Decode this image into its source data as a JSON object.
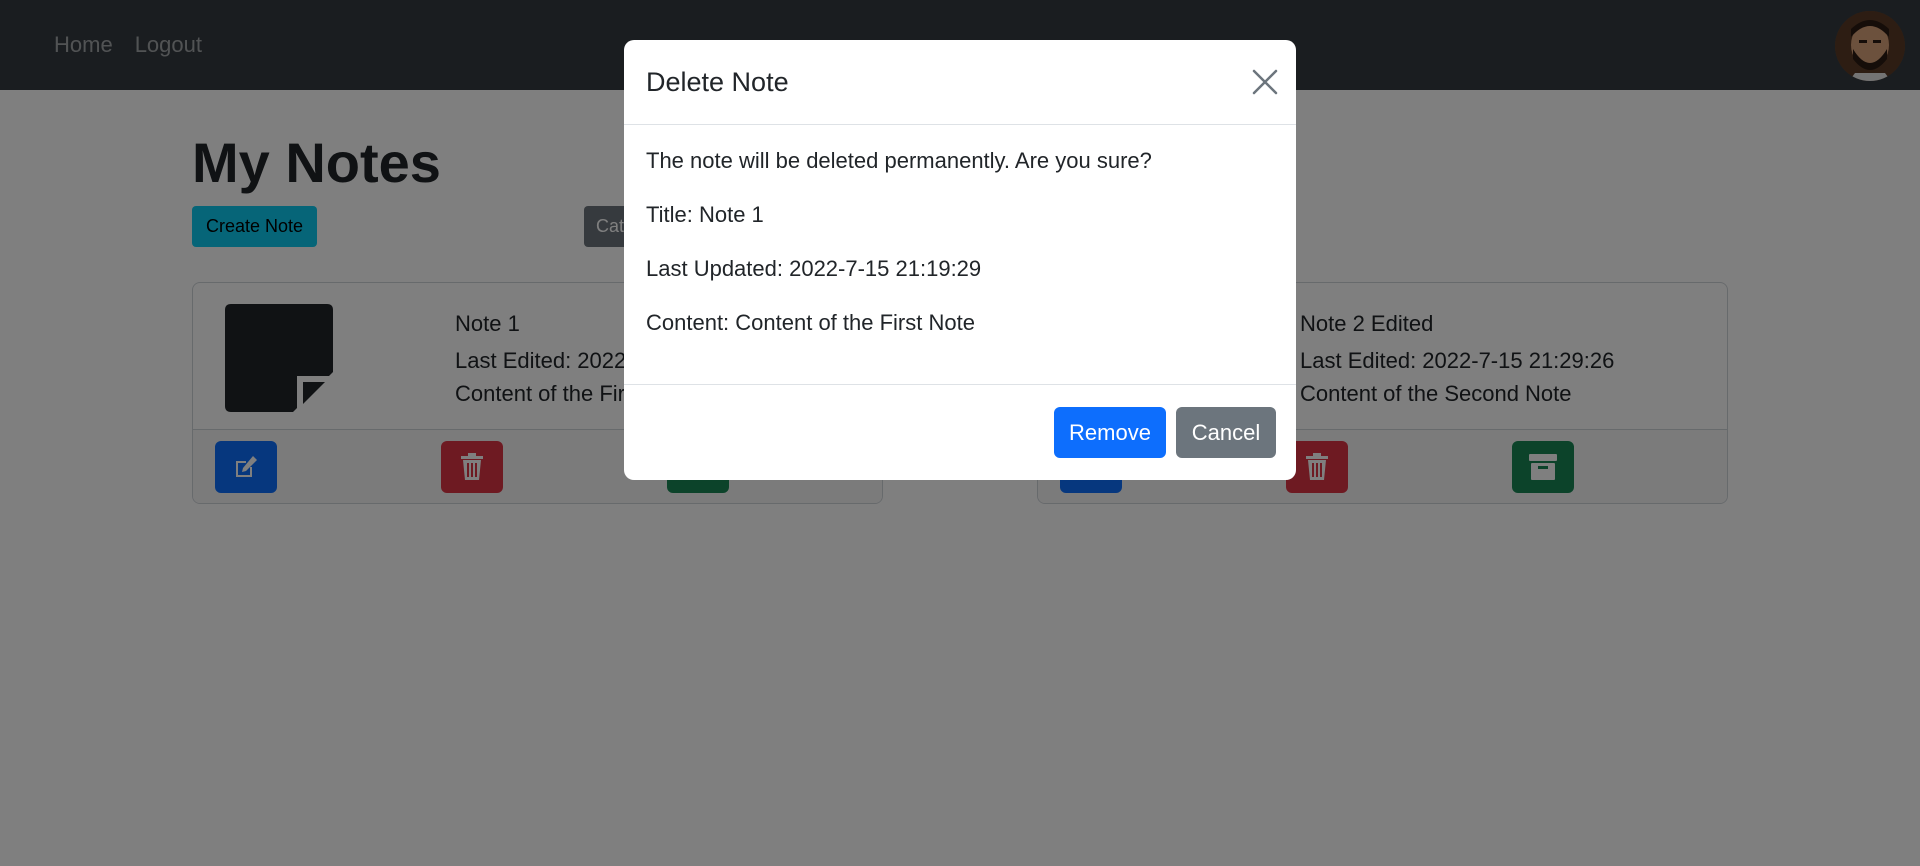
{
  "navbar": {
    "links": [
      "Home",
      "Logout"
    ],
    "avatar_icon": "user-avatar"
  },
  "page": {
    "title": "My Notes",
    "create_button": "Create Note",
    "category_button": "Cat"
  },
  "notes": [
    {
      "title": "Note 1",
      "last_edited": "Last Edited: 2022-",
      "content": "Content of the Fir",
      "actions": [
        "edit-icon",
        "trash-icon",
        "archive-icon"
      ]
    },
    {
      "title": "Note 2 Edited",
      "last_edited": "Last Edited: 2022-7-15 21:29:26",
      "content": "Content of the Second Note",
      "actions": [
        "edit-icon",
        "trash-icon",
        "archive-icon"
      ]
    }
  ],
  "modal": {
    "title": "Delete Note",
    "message": "The note will be deleted permanently. Are you sure?",
    "note_title": "Title: Note 1",
    "last_updated": "Last Updated: 2022-7-15 21:19:29",
    "content": "Content: Content of the First Note",
    "remove_label": "Remove",
    "cancel_label": "Cancel"
  },
  "colors": {
    "navbar": "#343a40",
    "primary": "#0d6efd",
    "danger": "#dc3545",
    "success": "#198754",
    "info": "#0dcaf0",
    "secondary": "#6c757d"
  }
}
